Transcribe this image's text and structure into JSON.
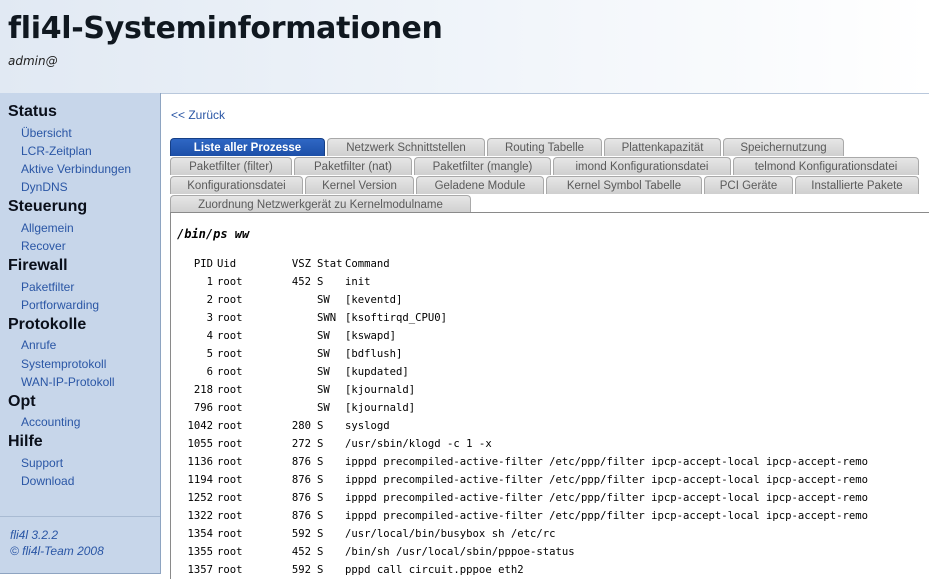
{
  "header": {
    "title": "fli4l-Systeminformationen",
    "user": "admin@"
  },
  "sidebar": {
    "sections": [
      {
        "title": "Status",
        "items": [
          "Übersicht",
          "LCR-Zeitplan",
          "Aktive Verbindungen",
          "DynDNS"
        ]
      },
      {
        "title": "Steuerung",
        "items": [
          "Allgemein",
          "Recover"
        ]
      },
      {
        "title": "Firewall",
        "items": [
          "Paketfilter",
          "Portforwarding"
        ]
      },
      {
        "title": "Protokolle",
        "items": [
          "Anrufe",
          "Systemprotokoll",
          "WAN-IP-Protokoll"
        ]
      },
      {
        "title": "Opt",
        "items": [
          "Accounting"
        ]
      },
      {
        "title": "Hilfe",
        "items": [
          "Support",
          "Download"
        ]
      }
    ],
    "footer": {
      "version": "fli4l 3.2.2",
      "copyright": "© fli4l-Team 2008"
    }
  },
  "main": {
    "back_link": "<< Zurück",
    "tabs": [
      [
        "Liste aller Prozesse",
        "Netzwerk Schnittstellen",
        "Routing Tabelle",
        "Plattenkapazität",
        "Speichernutzung"
      ],
      [
        "Paketfilter (filter)",
        "Paketfilter (nat)",
        "Paketfilter (mangle)",
        "imond Konfigurationsdatei",
        "telmond Konfigurationsdatei"
      ],
      [
        "Konfigurationsdatei",
        "Kernel Version",
        "Geladene Module",
        "Kernel Symbol Tabelle",
        "PCI Geräte",
        "Installierte Pakete"
      ],
      [
        "Zuordnung Netzwerkgerät zu Kernelmodulname"
      ]
    ],
    "active_tab": "Liste aller Prozesse",
    "command": "/bin/ps ww",
    "table": {
      "headers": [
        "PID",
        "Uid",
        "VSZ",
        "Stat",
        "Command"
      ],
      "rows": [
        [
          "1",
          "root",
          "452",
          "S",
          "init"
        ],
        [
          "2",
          "root",
          "",
          "SW",
          "[keventd]"
        ],
        [
          "3",
          "root",
          "",
          "SWN",
          "[ksoftirqd_CPU0]"
        ],
        [
          "4",
          "root",
          "",
          "SW",
          "[kswapd]"
        ],
        [
          "5",
          "root",
          "",
          "SW",
          "[bdflush]"
        ],
        [
          "6",
          "root",
          "",
          "SW",
          "[kupdated]"
        ],
        [
          "218",
          "root",
          "",
          "SW",
          "[kjournald]"
        ],
        [
          "796",
          "root",
          "",
          "SW",
          "[kjournald]"
        ],
        [
          "1042",
          "root",
          "280",
          "S",
          "syslogd"
        ],
        [
          "1055",
          "root",
          "272",
          "S",
          "/usr/sbin/klogd -c 1 -x"
        ],
        [
          "1136",
          "root",
          "876",
          "S",
          "ipppd precompiled-active-filter /etc/ppp/filter ipcp-accept-local ipcp-accept-remo"
        ],
        [
          "1194",
          "root",
          "876",
          "S",
          "ipppd precompiled-active-filter /etc/ppp/filter ipcp-accept-local ipcp-accept-remo"
        ],
        [
          "1252",
          "root",
          "876",
          "S",
          "ipppd precompiled-active-filter /etc/ppp/filter ipcp-accept-local ipcp-accept-remo"
        ],
        [
          "1322",
          "root",
          "876",
          "S",
          "ipppd precompiled-active-filter /etc/ppp/filter ipcp-accept-local ipcp-accept-remo"
        ],
        [
          "1354",
          "root",
          "592",
          "S",
          "/usr/local/bin/busybox sh /etc/rc"
        ],
        [
          "1355",
          "root",
          "452",
          "S",
          "/bin/sh /usr/local/sbin/pppoe-status"
        ],
        [
          "1357",
          "root",
          "592",
          "S",
          "pppd call circuit.pppoe eth2"
        ]
      ]
    }
  }
}
